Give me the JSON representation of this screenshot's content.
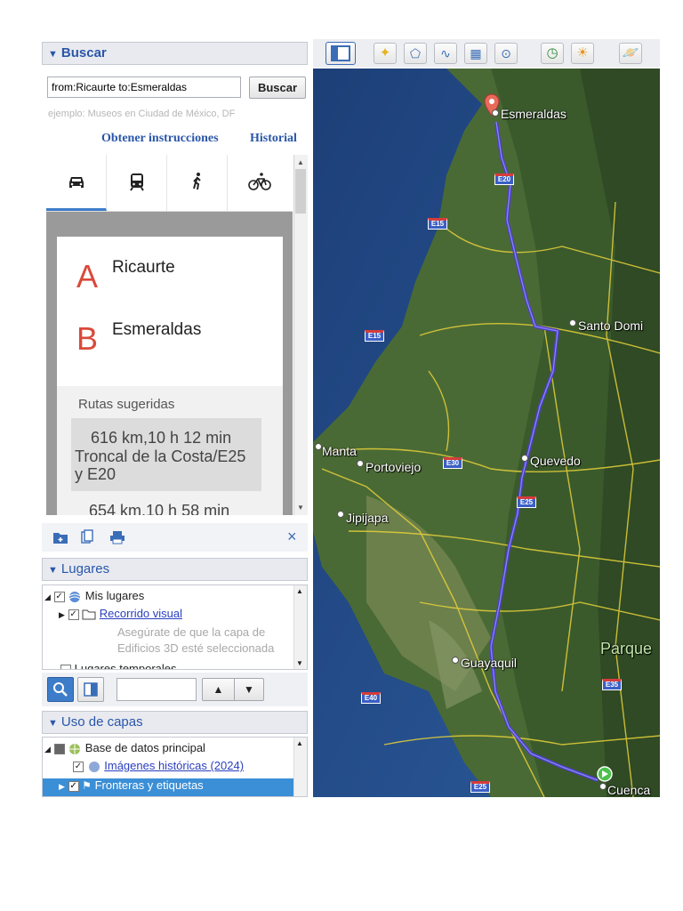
{
  "search_panel": {
    "header": "Buscar",
    "query": "from:Ricaurte to:Esmeraldas",
    "search_button": "Buscar",
    "hint": "ejemplo: Museos en Ciudad de México, DF",
    "directions_link": "Obtener instrucciones",
    "history_link": "Historial",
    "modes": [
      {
        "name": "car-icon",
        "active": true
      },
      {
        "name": "transit-icon",
        "active": false
      },
      {
        "name": "walk-icon",
        "active": false
      },
      {
        "name": "bike-icon",
        "active": false
      }
    ],
    "origin_letter": "A",
    "origin": "Ricaurte",
    "dest_letter": "B",
    "destination": "Esmeraldas",
    "suggested_routes_label": "Rutas sugeridas",
    "routes": [
      {
        "summary": "616 km,10 h 12 min",
        "via": "Troncal de la Costa/E25 y E20"
      },
      {
        "summary": "654 km,10 h 58 min",
        "via": ""
      }
    ]
  },
  "places_panel": {
    "header": "Lugares",
    "items": [
      {
        "label": "Mis lugares"
      },
      {
        "label": "Recorrido visual"
      },
      {
        "label": "Asegúrate de que la capa de Edificios 3D esté seleccionada"
      },
      {
        "label": "Lugares temporales"
      }
    ]
  },
  "layers_panel": {
    "header": "Uso de capas",
    "items": [
      {
        "label": "Base de datos principal"
      },
      {
        "label": "Imágenes históricas (2024)"
      },
      {
        "label": "Fronteras y etiquetas"
      }
    ]
  },
  "map": {
    "labels": {
      "esmeraldas": "Esmeraldas",
      "santo_domingo": "Santo Domi",
      "manta": "Manta",
      "portoviejo": "Portoviejo",
      "quevedo": "Quevedo",
      "jipijapa": "Jipijapa",
      "guayaquil": "Guayaquil",
      "cuenca": "Cuenca",
      "parque": "Parque"
    },
    "shields": [
      "E20",
      "E15",
      "E15",
      "E30",
      "E25",
      "E35",
      "E40",
      "E25"
    ]
  },
  "colors": {
    "accent": "#2a56a8",
    "route": "#4a3fc8",
    "marker_a": "#d94a3a",
    "selected_row": "#3b8fd6"
  }
}
